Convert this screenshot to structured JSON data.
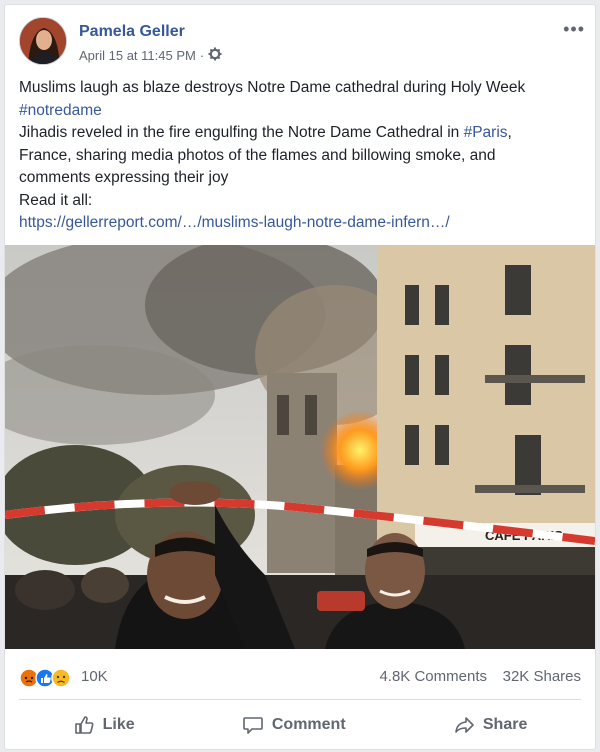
{
  "post": {
    "author": "Pamela Geller",
    "timestamp": "April 15 at 11:45 PM",
    "separator": "·",
    "privacy_icon": "gear-icon",
    "more_label": "•••",
    "lines": [
      "Muslims laugh as blaze destroys Notre Dame cathedral during Holy Week",
      "#notredame",
      "Jihadis reveled in the fire engulfing the Notre Dame Cathedral in",
      "#Paris",
      ",",
      "France, sharing media photos of the flames and billowing smoke, and",
      "comments expressing their joy",
      "Read it all:",
      "https://gellerreport.com/…/muslims-laugh-notre-dame-infern…/"
    ],
    "photo_sign_text": "CAFÉ PARIS"
  },
  "stats": {
    "reaction_icons": [
      "angry-icon",
      "like-icon",
      "sad-icon"
    ],
    "reaction_count": "10K",
    "comments": "4.8K Comments",
    "shares": "32K Shares"
  },
  "actions": {
    "like": "Like",
    "comment": "Comment",
    "share": "Share"
  },
  "colors": {
    "link": "#365899",
    "meta": "#616770",
    "like_blue": "#1877f2",
    "angry": "#e9710f",
    "sad": "#f7b928"
  }
}
